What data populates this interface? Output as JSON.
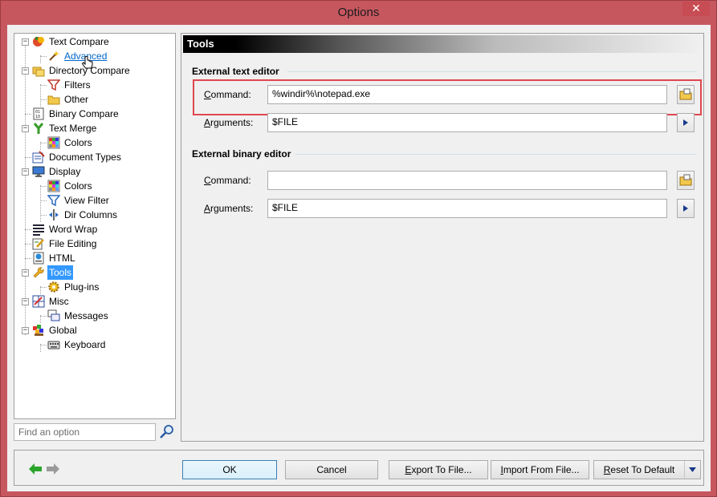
{
  "window": {
    "title": "Options",
    "close_glyph": "✕"
  },
  "tree": {
    "items": [
      {
        "label": "Text Compare",
        "icon": "text-compare-icon"
      },
      {
        "label": "Advanced",
        "icon": "wand-icon"
      },
      {
        "label": "Directory Compare",
        "icon": "folder-compare-icon"
      },
      {
        "label": "Filters",
        "icon": "filter-icon"
      },
      {
        "label": "Other",
        "icon": "folder-icon"
      },
      {
        "label": "Binary Compare",
        "icon": "binary-icon"
      },
      {
        "label": "Text Merge",
        "icon": "merge-icon"
      },
      {
        "label": "Colors",
        "icon": "palette-grid-icon"
      },
      {
        "label": "Document Types",
        "icon": "document-types-icon"
      },
      {
        "label": "Display",
        "icon": "monitor-icon"
      },
      {
        "label": "Colors",
        "icon": "palette-grid-icon"
      },
      {
        "label": "View Filter",
        "icon": "filter-icon"
      },
      {
        "label": "Dir Columns",
        "icon": "columns-icon"
      },
      {
        "label": "Word Wrap",
        "icon": "word-wrap-icon"
      },
      {
        "label": "File Editing",
        "icon": "edit-file-icon"
      },
      {
        "label": "HTML",
        "icon": "html-icon"
      },
      {
        "label": "Tools",
        "icon": "wrench-icon"
      },
      {
        "label": "Plug-ins",
        "icon": "gear-icon"
      },
      {
        "label": "Misc",
        "icon": "misc-icon"
      },
      {
        "label": "Messages",
        "icon": "messages-icon"
      },
      {
        "label": "Global",
        "icon": "global-icon"
      },
      {
        "label": "Keyboard",
        "icon": "keyboard-icon"
      }
    ]
  },
  "search": {
    "placeholder": "Find an option",
    "icon": "search-icon"
  },
  "panel": {
    "header": "Tools",
    "text_editor": {
      "title": "External text editor",
      "command_label_accel": "C",
      "command_label_rest": "ommand:",
      "command_value": "%windir%\\notepad.exe",
      "arguments_label_accel": "A",
      "arguments_label_rest": "rguments:",
      "arguments_value": "$FILE"
    },
    "binary_editor": {
      "title": "External binary editor",
      "command_label_accel": "C",
      "command_label_rest": "ommand:",
      "command_value": "",
      "arguments_label_accel": "A",
      "arguments_label_rest": "rguments:",
      "arguments_value": "$FILE"
    }
  },
  "buttons": {
    "ok": "OK",
    "cancel": "Cancel",
    "export_accel": "E",
    "export_rest": "xport To File...",
    "import_accel": "I",
    "import_rest": "mport From File...",
    "reset_accel": "R",
    "reset_rest": "eset To Default"
  },
  "colors": {
    "frame": "#c7575f",
    "selection": "#3399ff",
    "highlight_box": "#e0474f",
    "nav_back": "#2aa52a",
    "nav_forward": "#9a9a9a"
  }
}
